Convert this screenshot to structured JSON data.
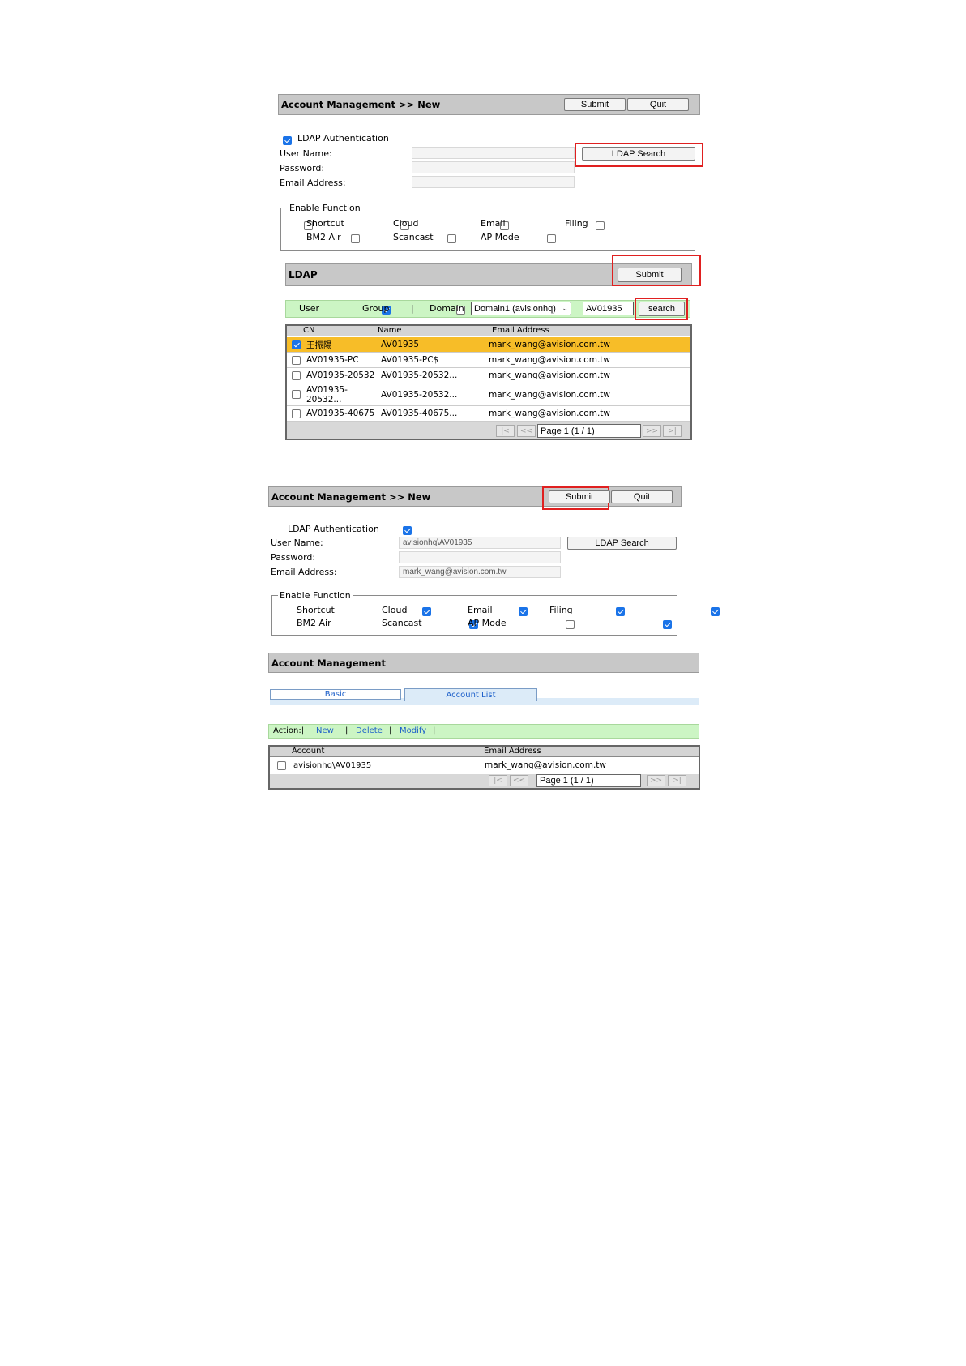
{
  "screen1": {
    "title": "Account Management >> New",
    "submit": "Submit",
    "quit": "Quit",
    "ldap_auth": "LDAP Authentication",
    "user_name_label": "User Name:",
    "password_label": "Password:",
    "email_label": "Email Address:",
    "ldap_search": "LDAP Search",
    "enable_function": "Enable Function",
    "functions": [
      "Shortcut",
      "Cloud",
      "Email",
      "Filing",
      "BM2 Air",
      "Scancast",
      "AP Mode"
    ]
  },
  "ldap": {
    "title": "LDAP",
    "submit": "Submit",
    "user": "User",
    "group": "Group",
    "domain": "Domain",
    "domain_select": "Domain1 (avisionhq)",
    "search_value": "AV01935",
    "search_button": "search",
    "columns": [
      "CN",
      "Name",
      "Email Address"
    ],
    "rows": [
      {
        "cn": "王振陽",
        "name": "AV01935",
        "email": "mark_wang@avision.com.tw",
        "checked": true
      },
      {
        "cn": "AV01935-PC",
        "name": "AV01935-PC$",
        "email": "mark_wang@avision.com.tw",
        "checked": false
      },
      {
        "cn": "AV01935-20532",
        "name": "AV01935-20532...",
        "email": "mark_wang@avision.com.tw",
        "checked": false
      },
      {
        "cn": "AV01935-",
        "cn2": "20532...",
        "name": "AV01935-20532...",
        "email": "mark_wang@avision.com.tw",
        "checked": false
      },
      {
        "cn": "AV01935-40675",
        "name": "AV01935-40675...",
        "email": "mark_wang@avision.com.tw",
        "checked": false
      }
    ],
    "pager": {
      "first": "|<",
      "prev": "<<",
      "page": "Page 1 (1 / 1)",
      "next": ">>",
      "last": ">|"
    }
  },
  "screen2": {
    "title": "Account Management >> New",
    "submit": "Submit",
    "quit": "Quit",
    "ldap_auth": "LDAP Authentication",
    "user_name_label": "User Name:",
    "user_name_value": "avisionhq\\AV01935",
    "password_label": "Password:",
    "email_label": "Email Address:",
    "email_value": "mark_wang@avision.com.tw",
    "ldap_search": "LDAP Search",
    "enable_function": "Enable Function",
    "functions": [
      "Shortcut",
      "Cloud",
      "Email",
      "Filing",
      "BM2 Air",
      "Scancast",
      "AP Mode"
    ]
  },
  "screen3": {
    "title": "Account Management",
    "tabs": [
      "Basic",
      "Account List"
    ],
    "action_label": "Action:|",
    "actions": [
      "New",
      "Delete",
      "Modify"
    ],
    "sep": "|",
    "columns": [
      "Account",
      "Email Address"
    ],
    "rows": [
      {
        "account": "avisionhq\\AV01935",
        "email": "mark_wang@avision.com.tw"
      }
    ],
    "pager": {
      "first": "|<",
      "prev": "<<",
      "page": "Page 1 (1 / 1)",
      "next": ">>",
      "last": ">|"
    }
  },
  "colors": {
    "highlight": "#e02020",
    "selected_row": "#f7bd28",
    "action_bar": "#ccf5c4",
    "checkbox": "#1a73e8"
  }
}
